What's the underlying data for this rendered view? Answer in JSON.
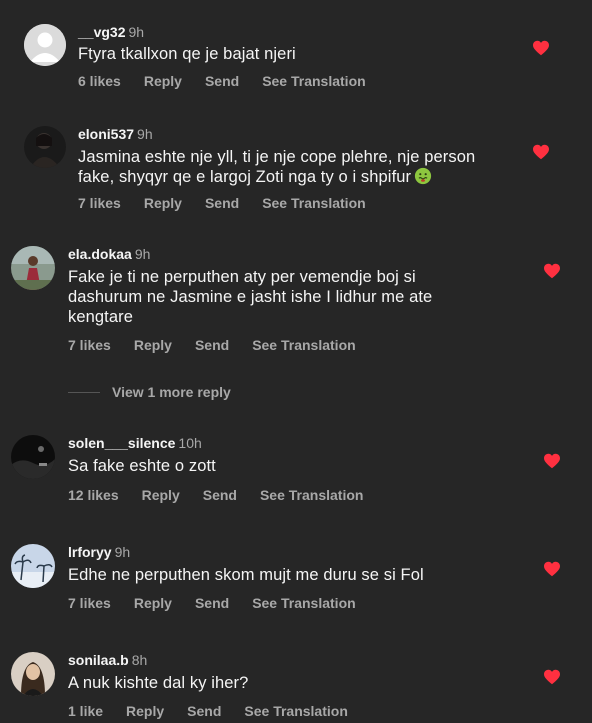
{
  "colors": {
    "background": "#262626",
    "heart": "#ff3040",
    "secondary": "#a8a8a8",
    "text": "#f5f5f5"
  },
  "comments": [
    {
      "username": "__vg32",
      "time": "9h",
      "text": "Ftyra tkallxon qe je bajat njeri",
      "likes": "6 likes",
      "reply": "Reply",
      "send": "Send",
      "translate": "See Translation",
      "liked": true
    },
    {
      "username": "eloni537",
      "time": "9h",
      "text_line1": "Jasmina eshte nje yll, ti je nje cope plehre, nje person",
      "text_line2": "fake, shyqyr qe e largoj Zoti nga ty o i shpifur",
      "emoji": "nauseated-face",
      "likes": "7 likes",
      "reply": "Reply",
      "send": "Send",
      "translate": "See Translation",
      "liked": true
    },
    {
      "username": "ela.dokaa",
      "time": "9h",
      "text_line1": "Fake je ti ne perputhen aty per vemendje boj si",
      "text_line2": "dashurum ne Jasmine e jasht ishe I lidhur me ate",
      "text_line3": "kengtare",
      "likes": "7 likes",
      "reply": "Reply",
      "send": "Send",
      "translate": "See Translation",
      "liked": true
    },
    {
      "username": "solen___silence",
      "time": "10h",
      "text": "Sa fake eshte o zott",
      "likes": "12 likes",
      "reply": "Reply",
      "send": "Send",
      "translate": "See Translation",
      "liked": true
    },
    {
      "username": "lrforyy",
      "time": "9h",
      "text": "Edhe ne perputhen skom mujt me duru se si Fol",
      "likes": "7 likes",
      "reply": "Reply",
      "send": "Send",
      "translate": "See Translation",
      "liked": true
    },
    {
      "username": "sonilaa.b",
      "time": "8h",
      "text": "A nuk kishte dal ky iher?",
      "likes": "1 like",
      "reply": "Reply",
      "send": "Send",
      "translate": "See Translation",
      "liked": true
    }
  ],
  "view_more": "View 1 more reply"
}
